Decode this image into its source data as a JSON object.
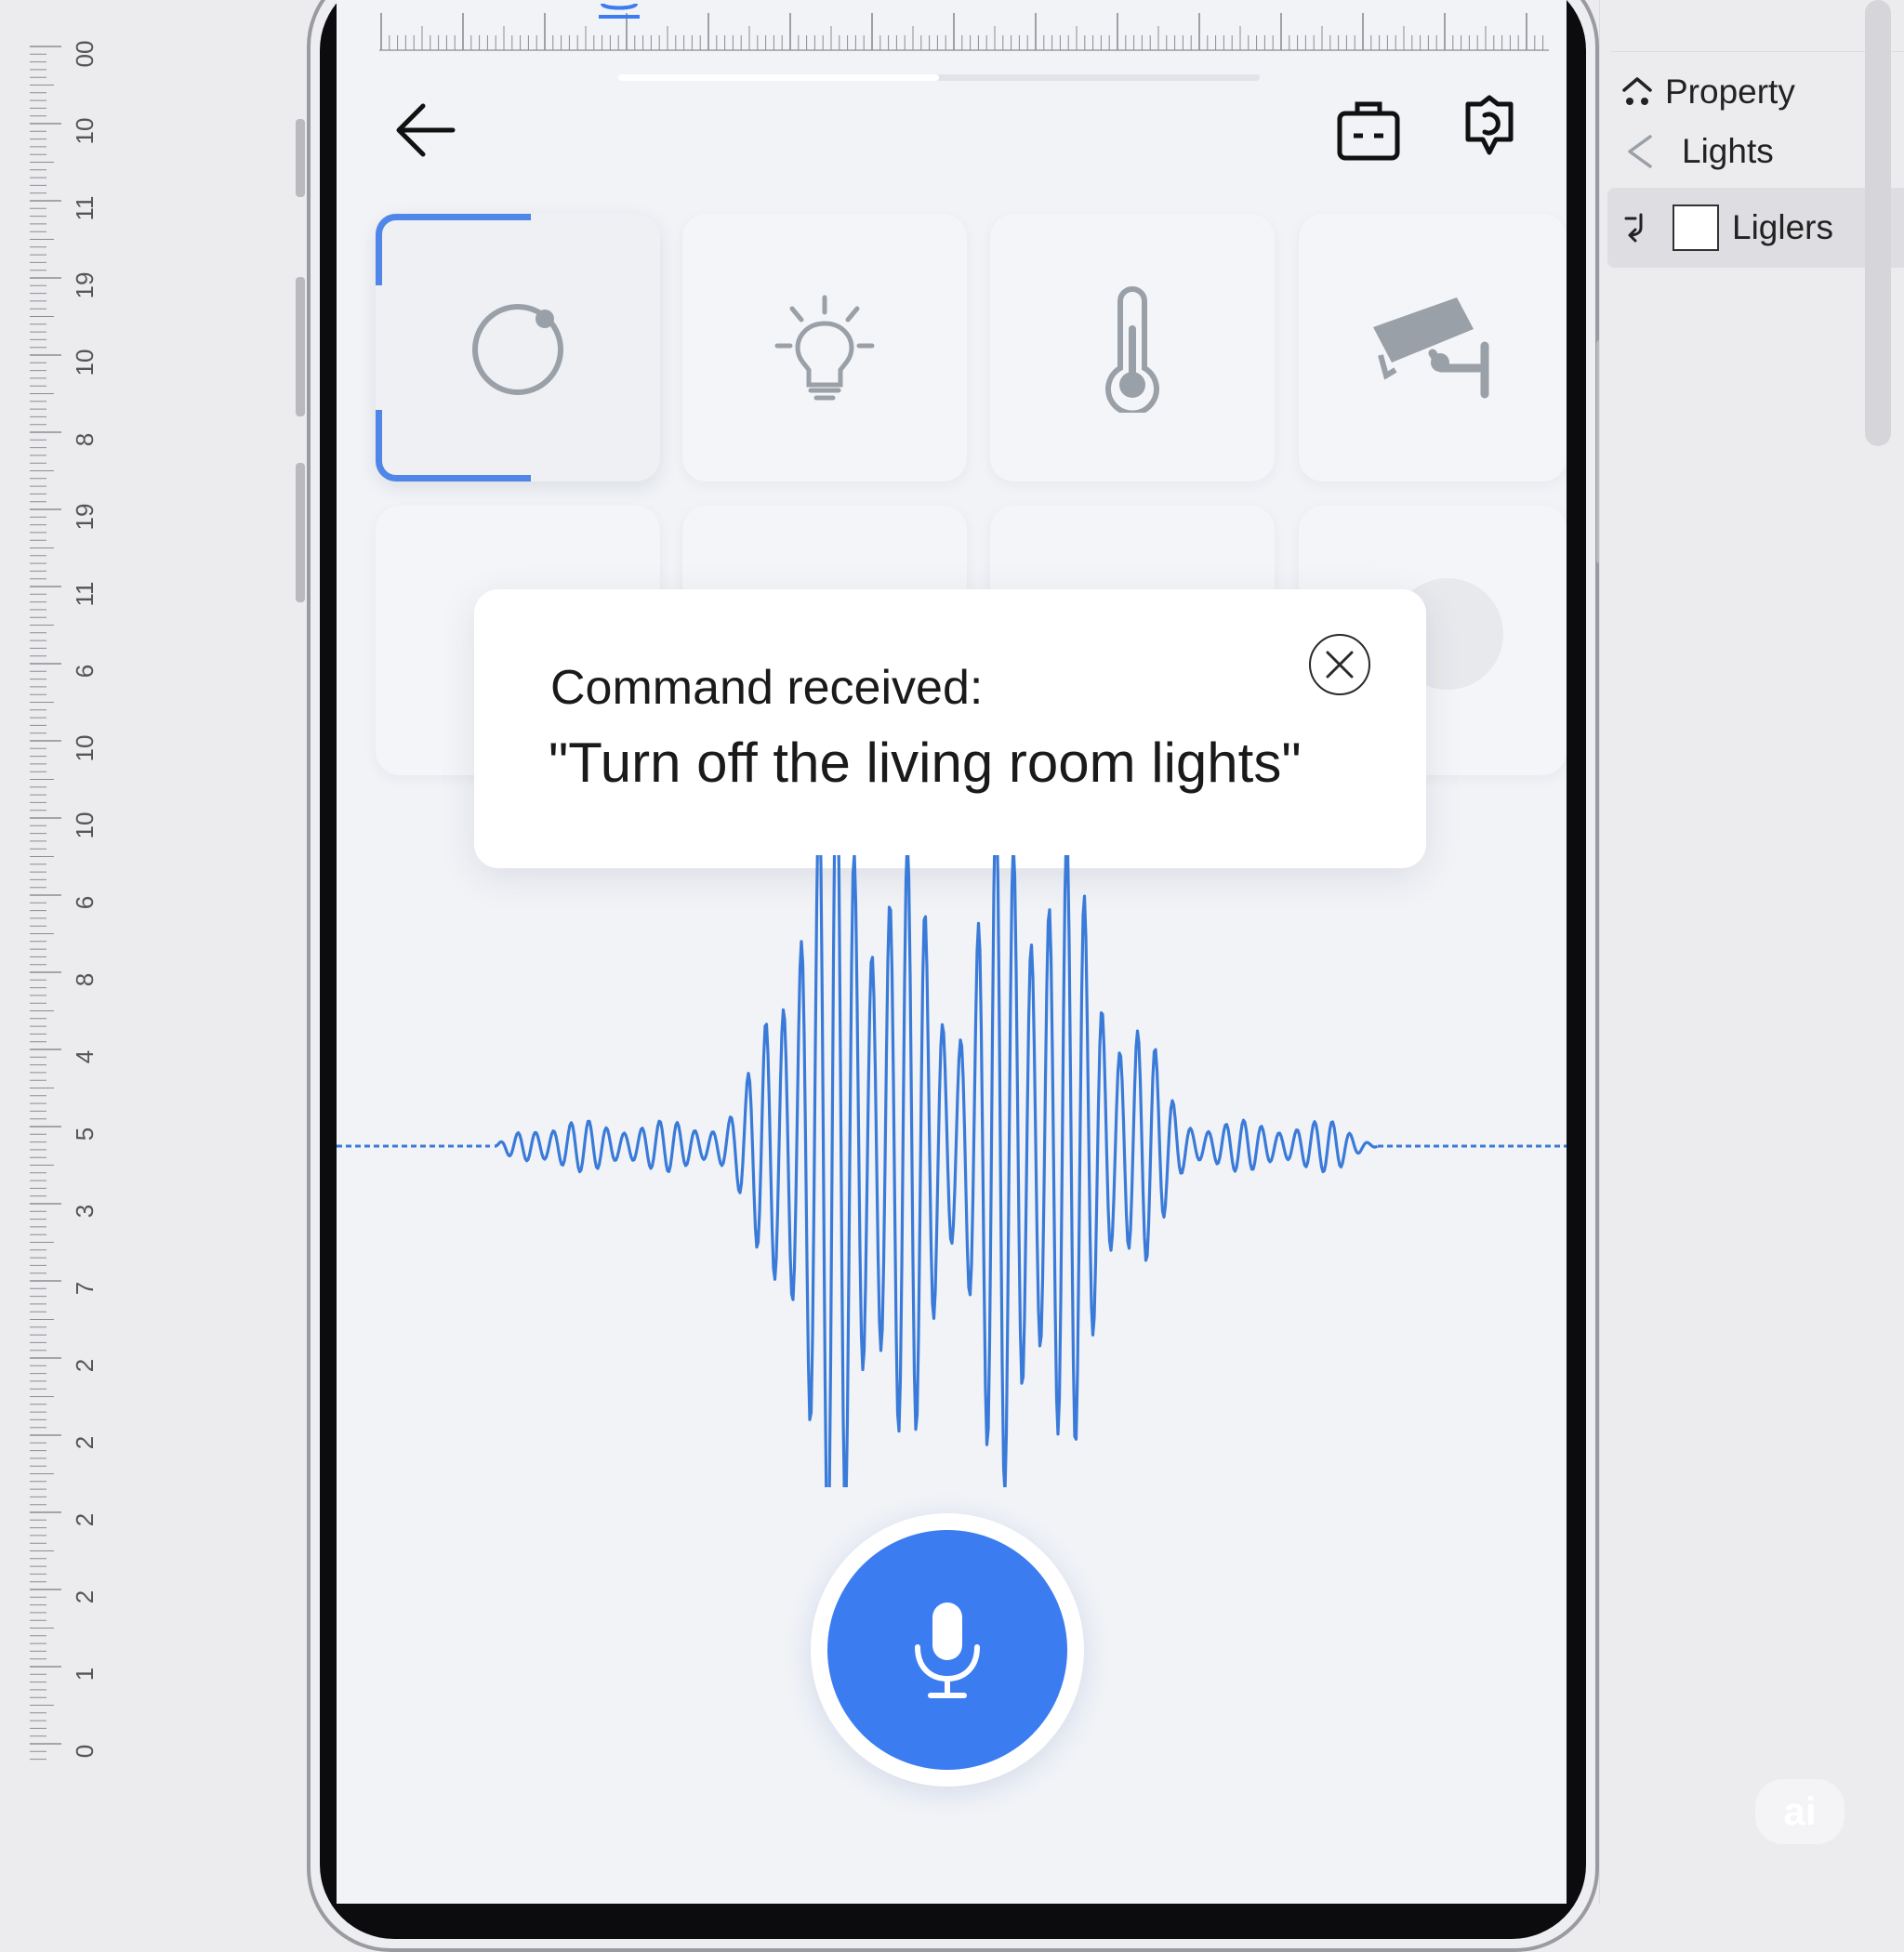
{
  "ruler_left": {
    "labels": [
      "00",
      "10",
      "11",
      "19",
      "10",
      "8",
      "19",
      "11",
      "6",
      "10",
      "10",
      "6",
      "8",
      "4",
      "5",
      "3",
      "7",
      "2",
      "2",
      "2",
      "2",
      "1",
      "0"
    ]
  },
  "ruler_top": {
    "selected_index": 3
  },
  "panel": {
    "items": [
      {
        "label": "Property",
        "icon": "home-icon"
      },
      {
        "label": "Lights",
        "icon": "chevron-left-icon"
      },
      {
        "label": "Liglers",
        "icon": "return-arrow-icon",
        "selected": true
      }
    ]
  },
  "header": {
    "back_icon": "arrow-left-icon",
    "icons": [
      "briefcase-icon",
      "settings-shield-icon"
    ]
  },
  "progress": {
    "value": 0.5
  },
  "device_tiles": [
    {
      "icon": "ring-icon",
      "active": true
    },
    {
      "icon": "light-bulb-icon"
    },
    {
      "icon": "thermometer-icon"
    },
    {
      "icon": "security-camera-icon"
    }
  ],
  "toast": {
    "line1": "Command received:",
    "line2": "\"Turn off the living room lights\"",
    "close_icon": "close-icon"
  },
  "mic": {
    "icon": "microphone-icon",
    "active": true
  },
  "watermark": "ai",
  "colors": {
    "accent": "#3b7cf0",
    "waveform": "#3a7ad8",
    "bracket": "#4f86e8",
    "icon_gray": "#9aa0a8",
    "screen_bg": "#f1f3f7"
  }
}
